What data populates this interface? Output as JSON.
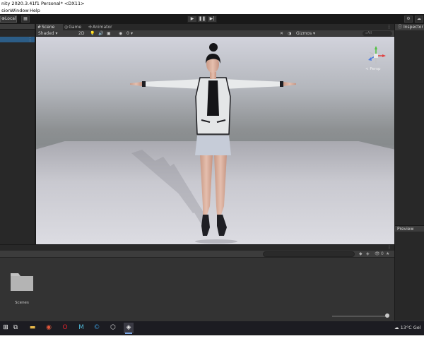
{
  "window": {
    "title": "nity 2020.3.41f1 Personal* <DX11>"
  },
  "menu": {
    "items": [
      "sion",
      "Window",
      "Help"
    ]
  },
  "toolbar": {
    "local_label": "Local",
    "play_icon": "play-icon",
    "pause_icon": "pause-icon",
    "step_icon": "step-icon"
  },
  "scene_tabs": [
    "Scene",
    "Game",
    "Animator"
  ],
  "scene_toolbar": {
    "shading_mode": "Shaded",
    "mode_2d": "2D",
    "gizmos_label": "Gizmos",
    "search_placeholder": "All",
    "hidden_count": "0"
  },
  "viewport": {
    "projection_label": "< Persp"
  },
  "right_panel": {
    "inspector_label": "Inspector",
    "preview_label": "Preview"
  },
  "project_panel": {
    "folder_name": "Scenes",
    "hidden_count": "0"
  },
  "taskbar": {
    "temperature": "13°C  Gel"
  },
  "colors": {
    "selection_blue": "#2c5d87",
    "panel_bg": "#282828",
    "gizmo_red": "#e04040",
    "gizmo_green": "#50c040"
  }
}
